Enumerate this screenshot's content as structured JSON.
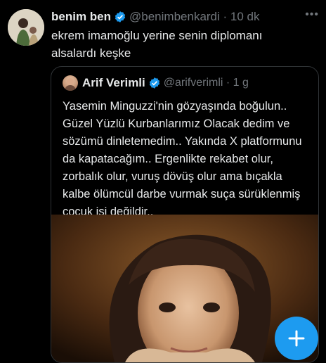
{
  "tweet": {
    "author_name": "benim ben",
    "handle_time": "@benimbenkardi · 10 dk",
    "text": "ekrem imamoğlu yerine senin diplomanı alsalardı keşke",
    "more_icon": "more-horizontal-icon"
  },
  "quoted_tweet": {
    "author_name": "Arif Verimli",
    "handle_time": "@arifverimli · 1 g",
    "text": "Yasemin Minguzzi'nin gözyaşında boğulun.. Güzel Yüzlü Kurbanlarımız Olacak dedim ve sözümü dinletemedim.. Yakında X platformunu da kapatacağım.. Ergenlikte rekabet olur, zorbalık olur, vuruş dövüş olur ama bıçakla kalbe ölümcül darbe vurmak suça sürüklenmiş çocuk işi değildir.."
  },
  "compose_button": {
    "icon": "plus-icon"
  },
  "colors": {
    "background": "#000000",
    "accent": "#1d9bf0",
    "muted": "#71767b",
    "border": "#2f3336"
  }
}
